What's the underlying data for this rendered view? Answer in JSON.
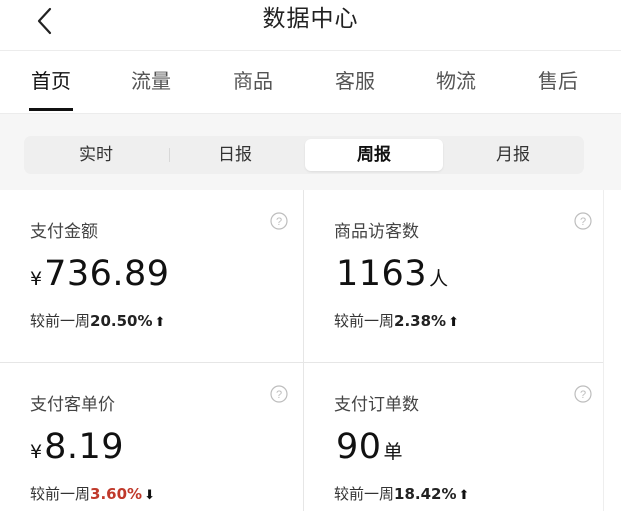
{
  "header": {
    "title": "数据中心"
  },
  "tabs": [
    {
      "label": "首页"
    },
    {
      "label": "流量"
    },
    {
      "label": "商品"
    },
    {
      "label": "客服"
    },
    {
      "label": "物流"
    },
    {
      "label": "售后"
    }
  ],
  "active_tab": "首页",
  "segments": [
    {
      "label": "实时"
    },
    {
      "label": "日报"
    },
    {
      "label": "周报"
    },
    {
      "label": "月报"
    }
  ],
  "active_segment": "周报",
  "metrics": [
    {
      "label": "支付金额",
      "prefix": "¥",
      "value": "736.89",
      "unit": "",
      "compare_label": "较前一周",
      "change": "20.50%",
      "direction": "up",
      "arrow": "⬆"
    },
    {
      "label": "商品访客数",
      "prefix": "",
      "value": "1163",
      "unit": "人",
      "compare_label": "较前一周",
      "change": "2.38%",
      "direction": "up",
      "arrow": "⬆"
    },
    {
      "label": "支付客单价",
      "prefix": "¥",
      "value": "8.19",
      "unit": "",
      "compare_label": "较前一周",
      "change": "3.60%",
      "direction": "down",
      "arrow": "⬇"
    },
    {
      "label": "支付订单数",
      "prefix": "",
      "value": "90",
      "unit": "单",
      "compare_label": "较前一周",
      "change": "18.42%",
      "direction": "up",
      "arrow": "⬆"
    }
  ],
  "icons": {
    "back": "chevron-left-icon",
    "help": "question-circle-icon"
  },
  "colors": {
    "decrease": "#c0392b",
    "active_tab_underline": "#111111",
    "segment_bg": "#efefef"
  }
}
